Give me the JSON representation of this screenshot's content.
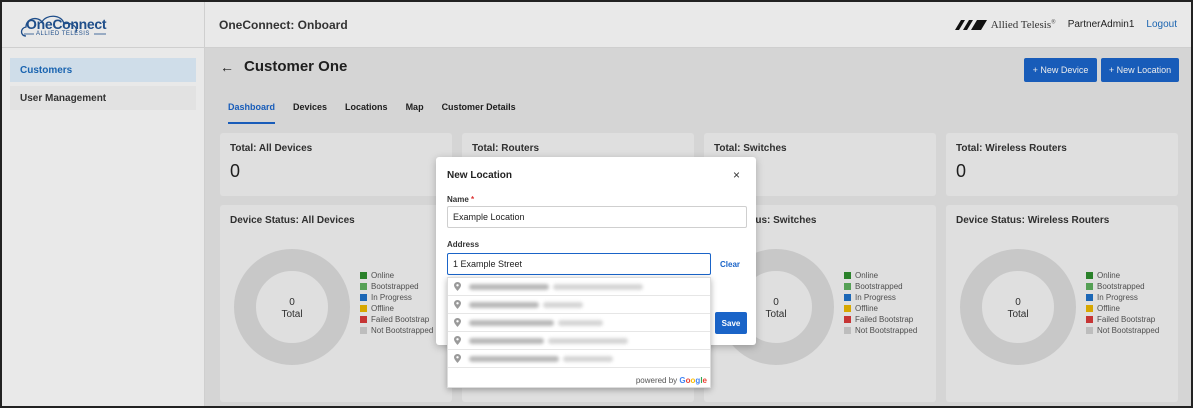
{
  "app": {
    "logo_main": "OneConnect",
    "logo_sub": "ALLIED TELESIS",
    "header_title": "OneConnect: Onboard",
    "brand_text": "Allied Telesis",
    "brand_tm": "®",
    "user": "PartnerAdmin1",
    "logout": "Logout"
  },
  "sidebar": {
    "items": [
      {
        "label": "Customers",
        "active": true
      },
      {
        "label": "User Management",
        "active": false
      }
    ]
  },
  "page": {
    "back": "←",
    "title": "Customer One",
    "new_device": "+ New Device",
    "new_location": "+ New Location"
  },
  "tabs": [
    {
      "label": "Dashboard",
      "active": true
    },
    {
      "label": "Devices"
    },
    {
      "label": "Locations"
    },
    {
      "label": "Map"
    },
    {
      "label": "Customer Details"
    }
  ],
  "totals": [
    {
      "title": "Total: All Devices",
      "value": "0"
    },
    {
      "title": "Total: Routers",
      "value": ""
    },
    {
      "title": "Total: Switches",
      "value": ""
    },
    {
      "title": "Total: Wireless Routers",
      "value": "0"
    }
  ],
  "status_cards": [
    {
      "title": "Device Status: All Devices",
      "count": "0",
      "label": "Total"
    },
    {
      "title": "",
      "count": "",
      "label": ""
    },
    {
      "title": "tus: Switches",
      "count": "0",
      "label": "Total"
    },
    {
      "title": "Device Status: Wireless Routers",
      "count": "0",
      "label": "Total"
    }
  ],
  "legend": [
    {
      "label": "Online",
      "color": "#2e8b2e"
    },
    {
      "label": "Bootstrapped",
      "color": "#5cad5c"
    },
    {
      "label": "In Progress",
      "color": "#1f6fc4"
    },
    {
      "label": "Offline",
      "color": "#e8b400"
    },
    {
      "label": "Failed Bootstrap",
      "color": "#d63a3a"
    },
    {
      "label": "Not Bootstrapped",
      "color": "#cccccc"
    }
  ],
  "modal": {
    "title": "New Location",
    "close": "×",
    "name_label": "Name",
    "required_mark": "*",
    "name_value": "Example Location",
    "address_label": "Address",
    "address_value": "1 Example Street",
    "clear": "Clear",
    "save": "Save"
  },
  "autocomplete": {
    "powered_by": "powered by",
    "google": [
      "G",
      "o",
      "o",
      "g",
      "l",
      "e"
    ]
  }
}
